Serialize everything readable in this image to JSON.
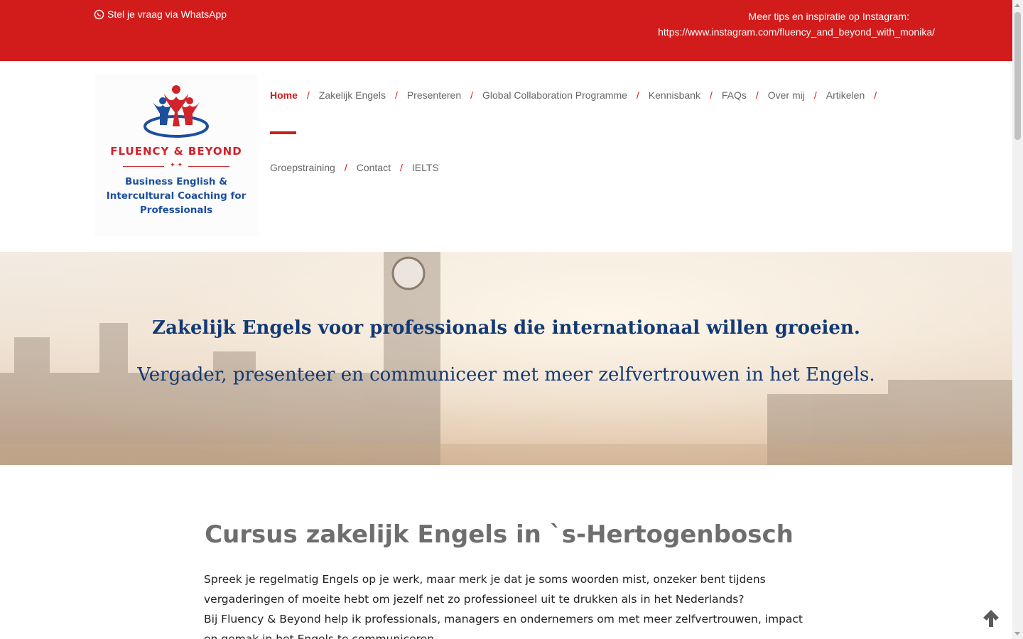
{
  "topbar": {
    "whatsapp_label": "Stel je vraag via WhatsApp",
    "instagram_intro": "Meer tips en inspiratie op Instagram:",
    "instagram_url": "https://www.instagram.com/fluency_and_beyond_with_monika/"
  },
  "logo": {
    "brand": "FLUENCY & BEYOND",
    "stars": "✦·✦",
    "tagline_1": "Business English &",
    "tagline_2": "Intercultural Coaching for",
    "tagline_3": "Professionals"
  },
  "nav": {
    "row1": [
      "Home",
      "Zakelijk Engels",
      "Presenteren",
      "Global Collaboration Programme",
      "Kennisbank",
      "FAQs",
      "Over mij",
      "Artikelen"
    ],
    "row2": [
      "Groepstraining",
      "Contact",
      "IELTS"
    ],
    "separator": "/",
    "active": "Home"
  },
  "hero": {
    "headline": "Zakelijk Engels voor professionals die internationaal willen groeien.",
    "subheadline": "Vergader, presenteer en communiceer met meer zelfvertrouwen in het Engels."
  },
  "content": {
    "heading": "Cursus zakelijk Engels in `s-Hertogenbosch",
    "para_1": "Spreek je regelmatig Engels op je werk, maar merk je dat je soms woorden mist, onzeker bent tijdens vergaderingen of moeite hebt om jezelf net zo professioneel uit te drukken als in het Nederlands?",
    "para_2": "Bij Fluency & Beyond help ik professionals, managers en ondernemers om met meer zelfvertrouwen, impact en gemak in het Engels te communiceren."
  },
  "colors": {
    "accent": "#d21c1c",
    "hero_text": "#133a74",
    "nav_text": "#666666"
  },
  "icons": {
    "whatsapp": "whatsapp-icon",
    "scroll_top": "arrow-up-icon"
  }
}
